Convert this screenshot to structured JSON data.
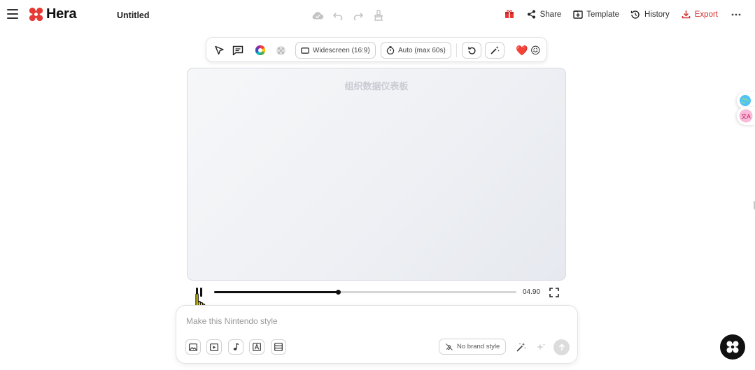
{
  "app": {
    "name": "Hera",
    "brand_color": "#e53935"
  },
  "header": {
    "doc_title": "Untitled",
    "actions": {
      "share_label": "Share",
      "template_label": "Template",
      "history_label": "History",
      "export_label": "Export"
    }
  },
  "toolbar": {
    "aspect_label": "Widescreen (16:9)",
    "duration_label": "Auto (max 60s)",
    "emoji_heart": "❤️",
    "emoji_face": "😖"
  },
  "canvas": {
    "title": "组织数据仪表板"
  },
  "player": {
    "time": "04.90",
    "progress": 0.41
  },
  "prompt": {
    "placeholder": "Make this Nintendo style",
    "brand_label": "No brand style"
  }
}
